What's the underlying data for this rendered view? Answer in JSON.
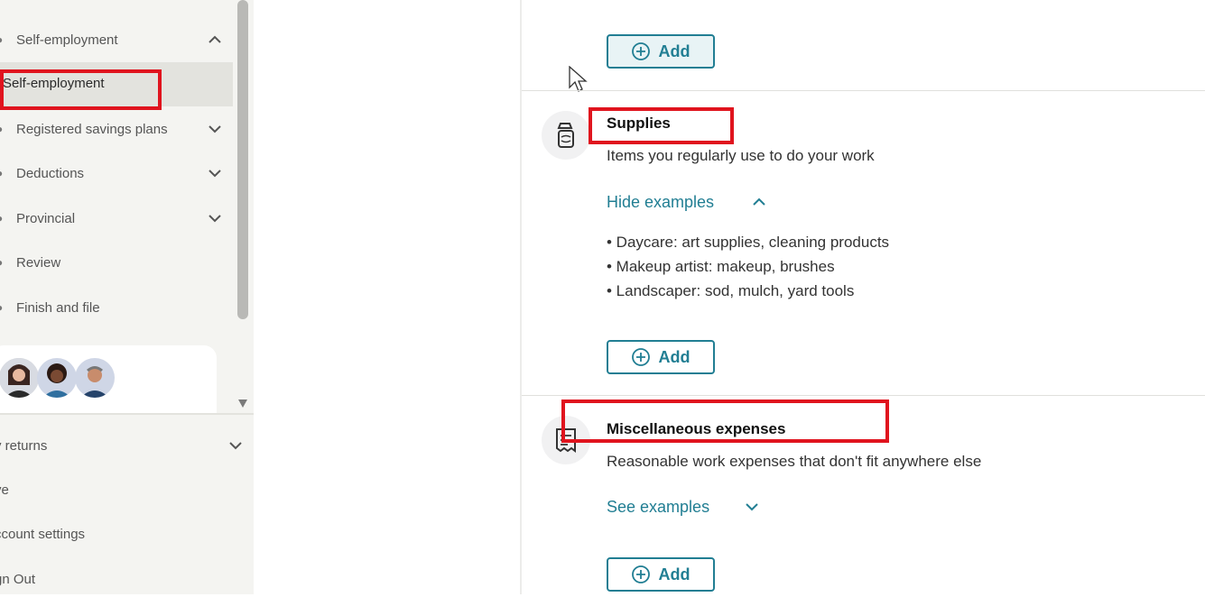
{
  "sidebar": {
    "items": [
      {
        "label": "Self-employment",
        "expanded": true
      },
      {
        "label": "Self-employment",
        "active": true
      },
      {
        "label": "Registered savings plans",
        "expanded": false
      },
      {
        "label": "Deductions",
        "expanded": false
      },
      {
        "label": "Provincial",
        "expanded": false
      },
      {
        "label": "Review"
      },
      {
        "label": "Finish and file"
      }
    ],
    "footer": [
      {
        "label": "y returns",
        "expanded": false
      },
      {
        "label": "ve"
      },
      {
        "label": "ccount settings"
      },
      {
        "label": "gn Out"
      }
    ]
  },
  "main": {
    "top_add_label": "Add",
    "sections": [
      {
        "title": "Supplies",
        "description": "Items you regularly use to do your work",
        "toggle_label": "Hide examples",
        "examples": [
          "• Daycare: art supplies, cleaning products",
          "• Makeup artist: makeup, brushes",
          "• Landscaper: sod, mulch, yard tools"
        ],
        "add_label": "Add",
        "icon": "spray-bottle-icon"
      },
      {
        "title": "Miscellaneous expenses",
        "description": "Reasonable work expenses that don't fit anywhere else",
        "toggle_label": "See examples",
        "add_label": "Add",
        "icon": "receipt-icon"
      }
    ]
  },
  "colors": {
    "accent": "#217e93",
    "highlight": "#e0141e",
    "sidebar_bg": "#f4f4f1"
  }
}
